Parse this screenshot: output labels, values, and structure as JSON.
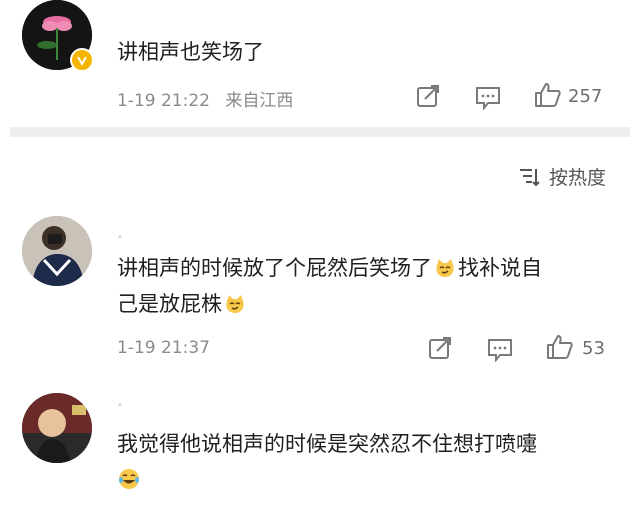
{
  "comments": [
    {
      "text": "讲相声也笑场了",
      "time": "1-19 21:22",
      "location": "来自江西",
      "likes": "257",
      "avatar_icon": "lotus-flower-avatar",
      "verified": true
    },
    {
      "text_line1": "讲相声的时候放了个屁然后笑场了",
      "text_line1b": "找补说自",
      "text_line2": "己是放屁株",
      "time": "1-19 21:37",
      "likes": "53",
      "avatar_icon": "person-photo-avatar"
    },
    {
      "text": "我觉得他说相声的时候是突然忍不住想打喷嚏",
      "avatar_icon": "bald-man-avatar"
    }
  ],
  "sort": {
    "label": "按热度",
    "icon": "sort-lines-icon"
  },
  "colors": {
    "accent": "#f5b400",
    "divider": "#eeeeee",
    "meta_text": "#8a8a8a"
  }
}
